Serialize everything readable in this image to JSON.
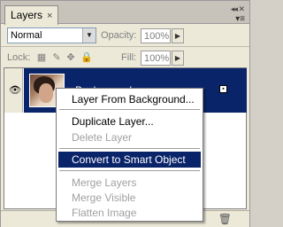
{
  "panel": {
    "tab_label": "Layers",
    "tab_close_glyph": "×",
    "window_controls": "◂◂ ✕",
    "menu_glyph": "▾≡"
  },
  "blend": {
    "mode_value": "Normal",
    "opacity_label": "Opacity:",
    "opacity_value": "100%"
  },
  "lock": {
    "label": "Lock:",
    "fill_label": "Fill:",
    "fill_value": "100%"
  },
  "layer": {
    "name": "Background"
  },
  "context_menu": {
    "items": [
      {
        "label": "Layer From Background...",
        "enabled": true
      },
      {
        "label": "Duplicate Layer...",
        "enabled": true
      },
      {
        "label": "Delete Layer",
        "enabled": false
      },
      {
        "label": "Convert to Smart Object",
        "enabled": true,
        "highlighted": true
      },
      {
        "label": "Merge Layers",
        "enabled": false
      },
      {
        "label": "Merge Visible",
        "enabled": false
      },
      {
        "label": "Flatten Image",
        "enabled": false
      }
    ]
  },
  "colors": {
    "selection": "#0a246a",
    "panel_bg": "#ece9d8"
  }
}
